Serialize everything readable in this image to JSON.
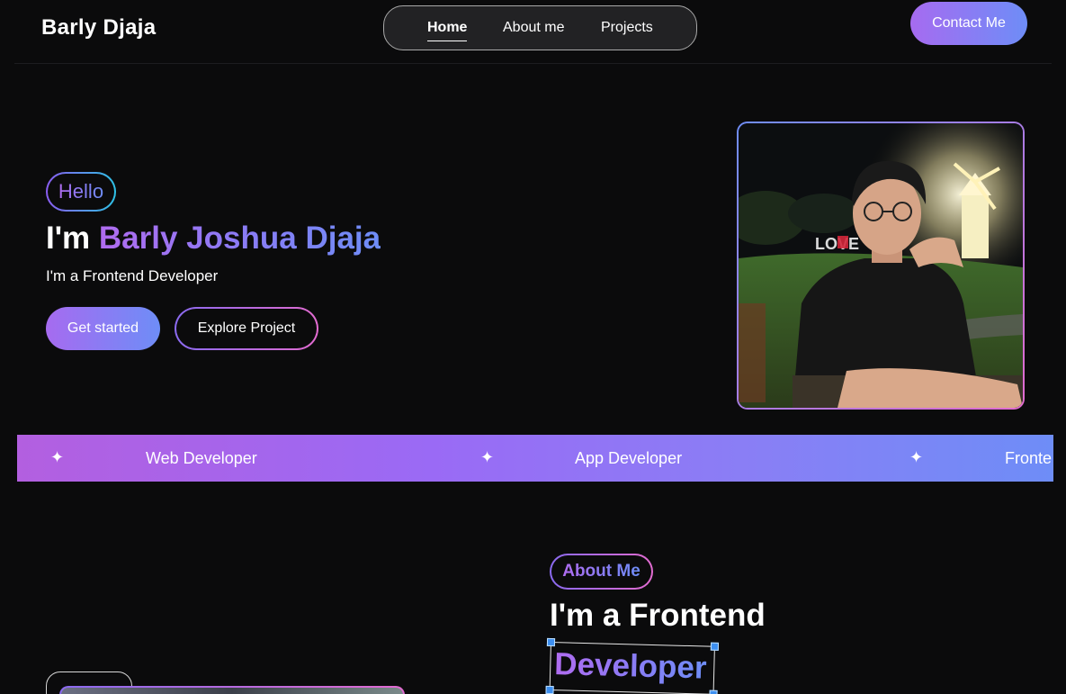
{
  "header": {
    "logo": "Barly Djaja",
    "nav": [
      {
        "label": "Home",
        "active": true
      },
      {
        "label": "About me",
        "active": false
      },
      {
        "label": "Projects",
        "active": false
      }
    ],
    "contact_label": "Contact Me"
  },
  "hero": {
    "hello": "Hello",
    "title_prefix": "I'm ",
    "title_name": "Barly Joshua Djaja",
    "subtitle": "I'm a Frontend Developer",
    "primary_button": "Get started",
    "secondary_button": "Explore Project"
  },
  "strip": {
    "items": [
      "Web Developer",
      "App Developer",
      "Fronte"
    ],
    "star": "✦"
  },
  "about": {
    "badge": "About Me",
    "title": "I'm a Frontend",
    "highlight": "Developer"
  },
  "colors": {
    "background": "#0b0b0c",
    "gradient_start": "#b06cf0",
    "gradient_end": "#6e8df7",
    "pink_accent": "#e26bd0",
    "handle_blue": "#3d8ff0"
  }
}
